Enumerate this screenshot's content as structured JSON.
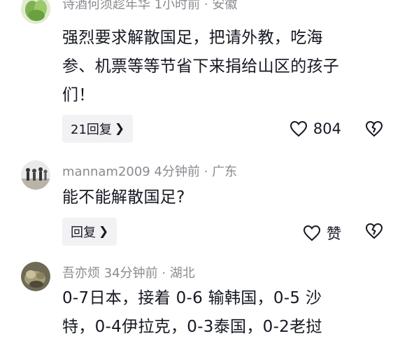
{
  "comments": [
    {
      "meta": "诗酒何须趁年华 1小时前 · 安徽",
      "text_lines": [
        "强烈要求解散国足，把请外教，吃海",
        "参、机票等等节省下来捐给山区的孩子",
        "们！"
      ],
      "reply_label": "21回复",
      "like_count": "804"
    },
    {
      "meta": "mannam2009  4分钟前 · 广东",
      "text_lines": [
        "能不能解散国足?"
      ],
      "reply_label": "回复",
      "like_count": "赞"
    },
    {
      "meta": "吾亦烦  34分钟前 · 湖北",
      "text_lines": [
        "0-7日本，接着 0-6 输韩国，0-5 沙",
        "特，0-4伊拉克，0-3泰国，0-2老挝"
      ]
    }
  ],
  "colors": {
    "meta": "#8a8b91",
    "text": "#161823",
    "reply_bg": "#f2f2f4",
    "hot_tag": "#ffe1e1"
  },
  "icons": {
    "like": "heart-outline-icon",
    "dislike": "broken-heart-icon",
    "chevron": "chevron-right-icon"
  }
}
